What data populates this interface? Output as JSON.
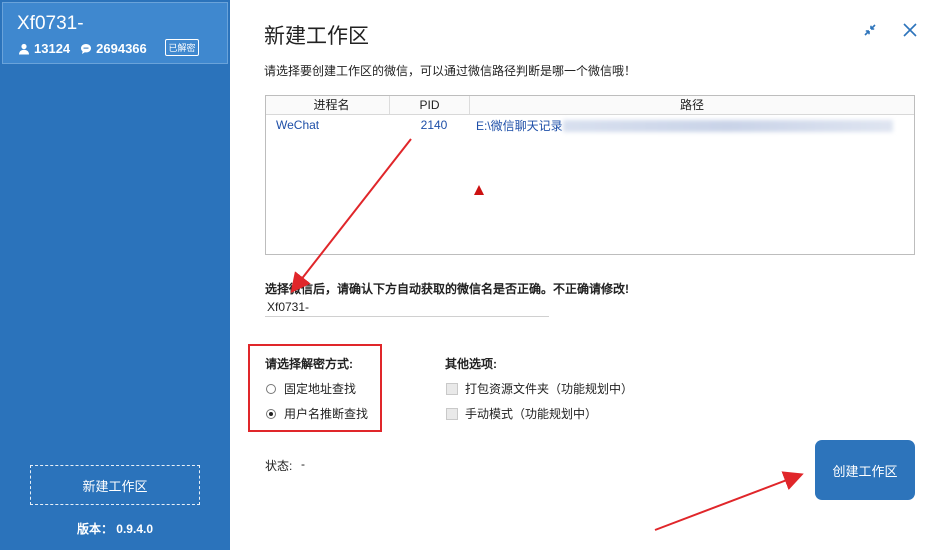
{
  "sidebar": {
    "account_name": "Xf0731-",
    "contacts_count": "13124",
    "messages_count": "2694366",
    "badge": "已解密",
    "create_button": "新建工作区",
    "version": "版本：  0.9.4.0"
  },
  "dialog": {
    "title": "新建工作区",
    "instruction": "请选择要创建工作区的微信，可以通过微信路径判断是哪一个微信哦！"
  },
  "process_table": {
    "headers": [
      "进程名",
      "PID",
      "路径"
    ],
    "rows": [
      {
        "name": "WeChat",
        "pid": "2140",
        "path": "E:\\微信聊天记录"
      }
    ]
  },
  "confirm": {
    "label": "选择微信后，请确认下方自动获取的微信名是否正确。不正确请修改!",
    "wechat_name": "Xf0731-"
  },
  "decrypt": {
    "label": "请选择解密方式:",
    "options": [
      {
        "label": "固定地址查找",
        "selected": false
      },
      {
        "label": "用户名推断查找",
        "selected": true
      }
    ]
  },
  "other_options": {
    "label": "其他选项:",
    "items": [
      {
        "label": "打包资源文件夹（功能规划中）",
        "checked": false
      },
      {
        "label": "手动模式（功能规划中）",
        "checked": false
      }
    ]
  },
  "status": {
    "label": "状态:",
    "value": "-"
  },
  "create_button": "创建工作区",
  "colors": {
    "sidebar": "#2b73bb",
    "primary_button": "#2d74bb",
    "annotation": "#e0262a"
  }
}
